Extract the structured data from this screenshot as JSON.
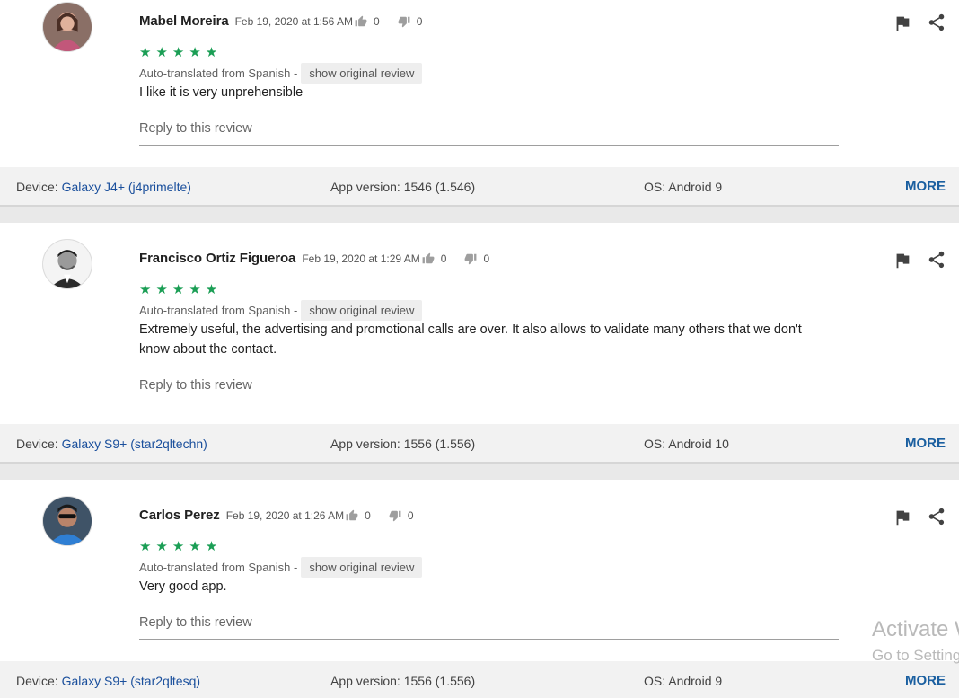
{
  "reviews": [
    {
      "author": "Mabel Moreira",
      "date": "Feb 19, 2020 at 1:56 AM",
      "upvotes": "0",
      "downvotes": "0",
      "stars": "★★★★★",
      "rating": 5,
      "translated_label": "Auto-translated from Spanish -",
      "show_original": "show original review",
      "text": "I like it is very unprehensible",
      "reply": "Reply to this review",
      "device_label": "Device: ",
      "device": "Galaxy J4+ (j4primelte)",
      "app_version": "App version: 1546 (1.546)",
      "os": "OS: Android 9",
      "more": "MORE"
    },
    {
      "author": "Francisco Ortiz Figueroa",
      "date": "Feb 19, 2020 at 1:29 AM",
      "upvotes": "0",
      "downvotes": "0",
      "stars": "★★★★★",
      "rating": 5,
      "translated_label": "Auto-translated from Spanish -",
      "show_original": "show original review",
      "text": "Extremely useful, the advertising and promotional calls are over. It also allows to validate many others that we don't know about the contact.",
      "reply": "Reply to this review",
      "device_label": "Device: ",
      "device": "Galaxy S9+ (star2qltechn)",
      "app_version": "App version: 1556 (1.556)",
      "os": "OS: Android 10",
      "more": "MORE"
    },
    {
      "author": "Carlos Perez",
      "date": "Feb 19, 2020 at 1:26 AM",
      "upvotes": "0",
      "downvotes": "0",
      "stars": "★★★★★",
      "rating": 5,
      "translated_label": "Auto-translated from Spanish -",
      "show_original": "show original review",
      "text": "Very good app.",
      "reply": "Reply to this review",
      "device_label": "Device: ",
      "device": "Galaxy S9+ (star2qltesq)",
      "app_version": "App version: 1556 (1.556)",
      "os": "OS: Android 9",
      "more": "MORE"
    }
  ],
  "watermark": {
    "line1": "Activate Windows",
    "line2": "Go to Settings to activate Windows."
  },
  "colors": {
    "star": "#1b9e55",
    "link": "#1a5fa0",
    "device_link": "#1a4f9c"
  },
  "icons": [
    "thumbs-up-icon",
    "thumbs-down-icon",
    "flag-icon",
    "share-icon"
  ]
}
